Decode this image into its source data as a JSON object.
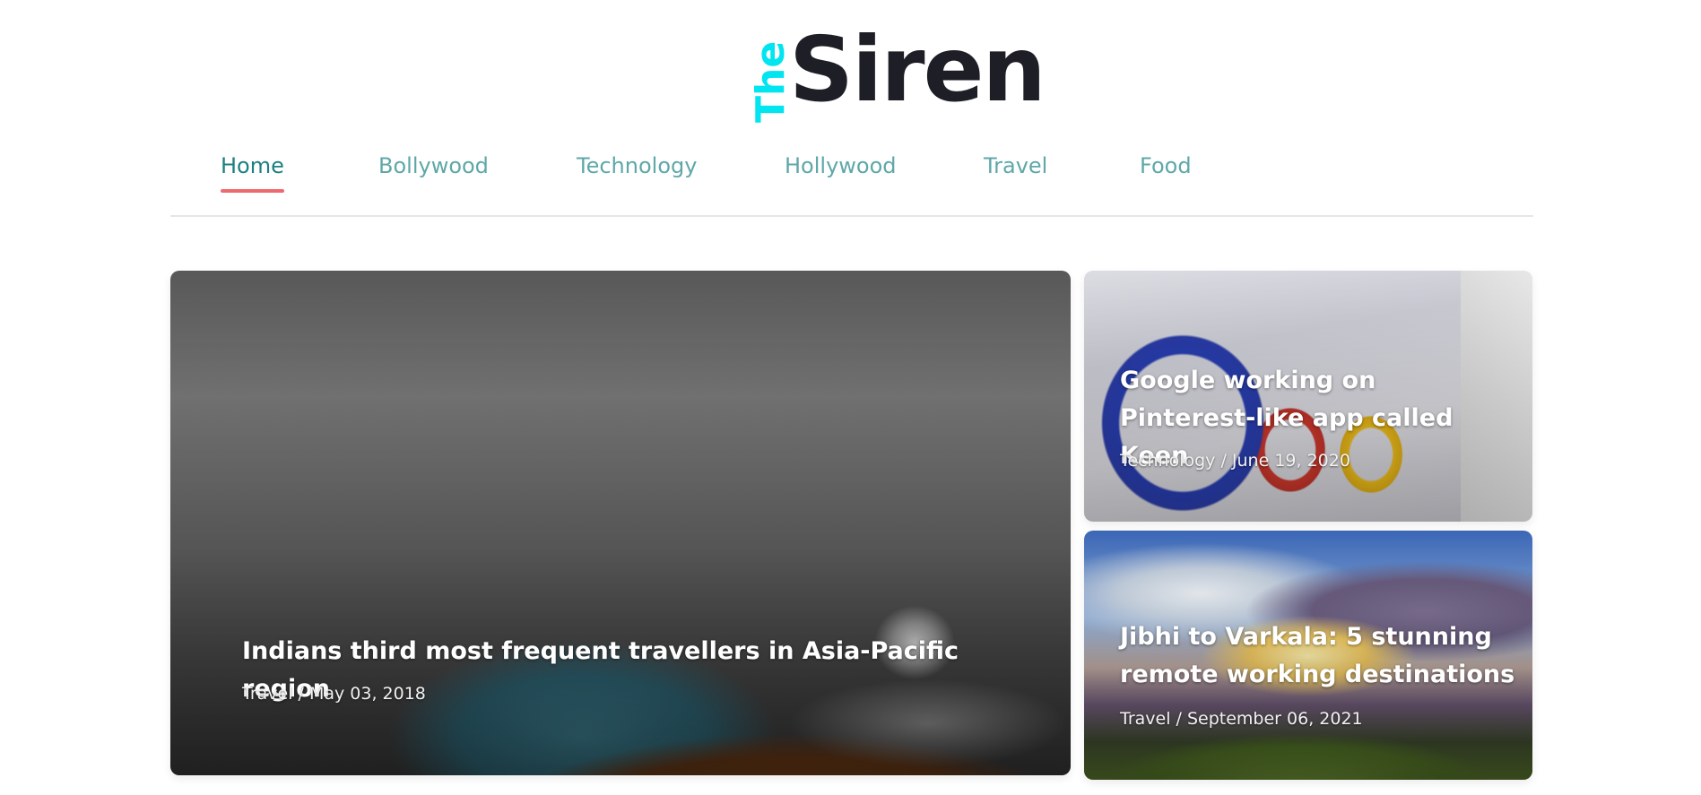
{
  "logo": {
    "small": "The",
    "main": "Siren",
    "accent_color": "#00e5f0"
  },
  "nav": {
    "items": [
      {
        "label": "Home",
        "active": true
      },
      {
        "label": "Bollywood",
        "active": false
      },
      {
        "label": "Technology",
        "active": false
      },
      {
        "label": "Hollywood",
        "active": false
      },
      {
        "label": "Travel",
        "active": false
      },
      {
        "label": "Food",
        "active": false
      }
    ],
    "active_underline_color": "#ef6a6f"
  },
  "articles": [
    {
      "title": "Indians third most frequent travellers in Asia-Pacific region",
      "category": "Travel",
      "date": "May 03, 2018",
      "meta": "Travel / May 03, 2018",
      "image": "suitcase-with-camera-and-scarf"
    },
    {
      "title": "Google working on Pinterest-like app called Keen",
      "category": "Technology",
      "date": "June 19, 2020",
      "meta": "Technology / June 19, 2020",
      "image": "google-logo-sign"
    },
    {
      "title": "Jibhi to Varkala: 5 stunning remote working destinations",
      "category": "Travel",
      "date": "September 06, 2021",
      "meta": "Travel / September 06, 2021",
      "image": "mountain-landscape-sunset"
    }
  ]
}
